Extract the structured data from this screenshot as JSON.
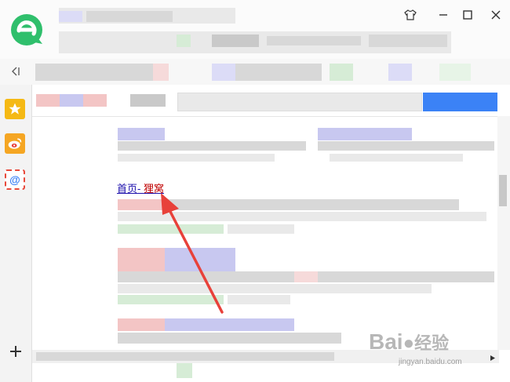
{
  "window": {
    "skin_icon": "tshirt-icon",
    "minimize_icon": "minimize-icon",
    "maximize_icon": "maximize-icon",
    "close_icon": "close-icon"
  },
  "toolbar": {
    "sidebar_toggle_icon": "collapse-sidebar-icon"
  },
  "sidebar": {
    "items": [
      {
        "icon": "star-icon",
        "color": "#f5b914"
      },
      {
        "icon": "weibo-icon",
        "color": "#f5a623"
      },
      {
        "icon": "email-icon",
        "color": "#e84a3c"
      }
    ],
    "add_icon": "plus-icon"
  },
  "result": {
    "link_prefix": "首页- ",
    "link_highlight": "狸窝"
  },
  "watermark": {
    "brand": "Bai",
    "brand2": "经验",
    "url": "jingyan.baidu.com"
  },
  "colors": {
    "logo": "#2fbf6c",
    "accent_blue": "#3b82f6",
    "arrow": "#e8413a"
  }
}
